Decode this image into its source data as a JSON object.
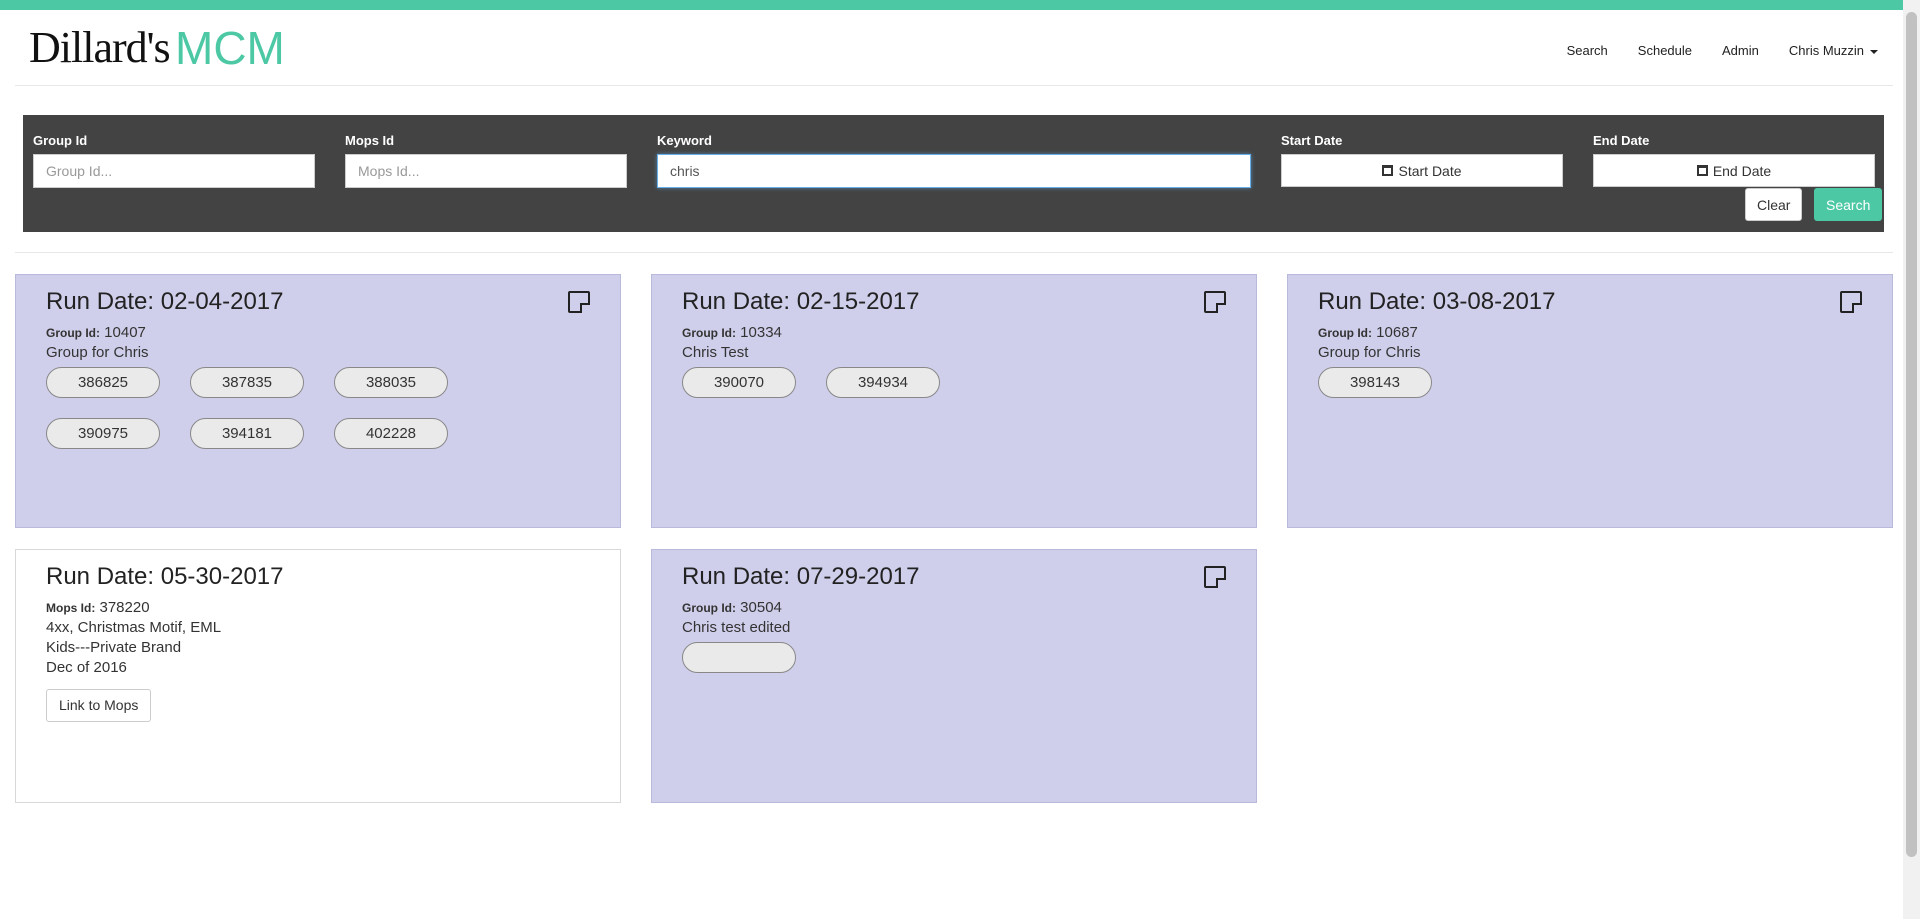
{
  "header": {
    "logo_text": "Dillard's",
    "app_name": "MCM",
    "nav": [
      "Search",
      "Schedule",
      "Admin",
      "Chris Muzzin"
    ]
  },
  "search": {
    "group_id_label": "Group Id",
    "group_id_placeholder": "Group Id...",
    "mops_id_label": "Mops Id",
    "mops_id_placeholder": "Mops Id...",
    "keyword_label": "Keyword",
    "keyword_value": "chris",
    "start_date_label": "Start Date",
    "start_date_button": "Start Date",
    "end_date_label": "End Date",
    "end_date_button": "End Date",
    "clear_label": "Clear",
    "search_label": "Search"
  },
  "colors": {
    "accent": "#4dc8a4",
    "panel": "#434343",
    "group_card": "#cfcfec"
  },
  "cards": [
    {
      "type": "group",
      "title": "Run Date: 02-04-2017",
      "id_label": "Group Id:",
      "id_value": "10407",
      "lines": [
        "Group for Chris"
      ],
      "pills": [
        "386825",
        "387835",
        "388035",
        "390975",
        "394181",
        "402228"
      ]
    },
    {
      "type": "group",
      "title": "Run Date: 02-15-2017",
      "id_label": "Group Id:",
      "id_value": "10334",
      "lines": [
        "Chris Test"
      ],
      "pills": [
        "390070",
        "394934"
      ]
    },
    {
      "type": "group",
      "title": "Run Date: 03-08-2017",
      "id_label": "Group Id:",
      "id_value": "10687",
      "lines": [
        "Group for Chris"
      ],
      "pills": [
        "398143"
      ]
    },
    {
      "type": "mops",
      "title": "Run Date: 05-30-2017",
      "id_label": "Mops Id:",
      "id_value": "378220",
      "lines": [
        "4xx, Christmas Motif, EML",
        "Kids---Private Brand",
        "Dec of 2016"
      ],
      "link_label": "Link to Mops"
    },
    {
      "type": "group",
      "title": "Run Date: 07-29-2017",
      "id_label": "Group Id:",
      "id_value": "30504",
      "lines": [
        "Chris test edited"
      ],
      "pills": [
        ""
      ]
    }
  ]
}
